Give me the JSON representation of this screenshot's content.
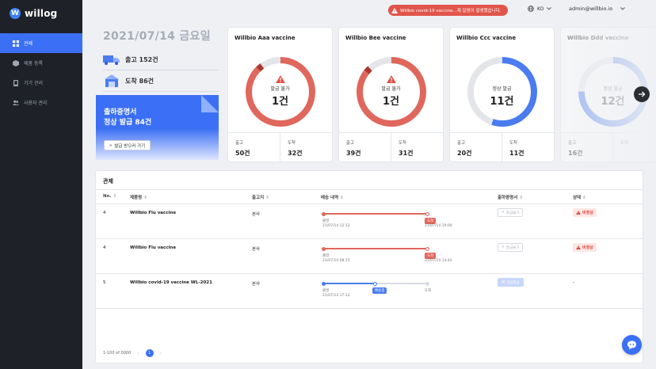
{
  "app": {
    "logo_letter": "W",
    "name": "willog"
  },
  "sidebar": {
    "items": [
      {
        "label": "관제",
        "icon": "grid-icon",
        "active": true
      },
      {
        "label": "제품 등록",
        "icon": "box-icon",
        "active": false
      },
      {
        "label": "기기 관리",
        "icon": "device-icon",
        "active": false
      },
      {
        "label": "사용자 관리",
        "icon": "users-icon",
        "active": false
      }
    ]
  },
  "topbar": {
    "alert_text": "Willbio covid-19 vaccine...제 알람이 발생했습니다.",
    "language": "KO",
    "user": "admin@willbio.io"
  },
  "summary": {
    "date": "2021/07/14 금요일",
    "outbound": "출고 152건",
    "arrival": "도착 86건"
  },
  "promo": {
    "line1": "출하증명서",
    "line2": "정상 발급 84건",
    "button": "발급 받으러 가기"
  },
  "cards": [
    {
      "title": "Willbio Aaa vaccine",
      "status_label": "발급 불가",
      "count": "1건",
      "out_label": "출고",
      "out_value": "50건",
      "arr_label": "도착",
      "arr_value": "32건",
      "fraction": 0.9,
      "color": "#e0675c"
    },
    {
      "title": "Willbio Bee vaccine",
      "status_label": "발급 불가",
      "count": "1건",
      "out_label": "출고",
      "out_value": "39건",
      "arr_label": "도착",
      "arr_value": "31건",
      "fraction": 0.88,
      "color": "#e0675c"
    },
    {
      "title": "Willbio Ccc vaccine",
      "status_label": "정상 발급",
      "count": "11건",
      "out_label": "출고",
      "out_value": "20건",
      "arr_label": "도착",
      "arr_value": "11건",
      "fraction": 0.55,
      "color": "#4a7cf0"
    },
    {
      "title": "Willbio Ddd vaccine",
      "status_label": "정상 발급",
      "count": "12건",
      "out_label": "출고",
      "out_value": "16건",
      "arr_label": "도착",
      "arr_value": "",
      "fraction": 0.75,
      "color": "#4a7cf0"
    }
  ],
  "table": {
    "title": "관제",
    "columns": [
      "No.",
      "제품명",
      "출고지",
      "배송 내역",
      "출하증명서",
      "상태"
    ],
    "rows": [
      {
        "no": "4",
        "name": "Willbio Flu vaccine",
        "origin": "본사",
        "start_label": "출발",
        "start_time": "21/07/14 12:12",
        "end_tag": "도착",
        "end_time": "21/07/14 19:00",
        "cert": "발급불가",
        "status": "비정상"
      },
      {
        "no": "4",
        "name": "Willbio Flu vaccine",
        "origin": "본사",
        "start_label": "출발",
        "start_time": "21/07/14 08:15",
        "end_tag": "도착",
        "end_time": "21/07/14 14:42",
        "cert": "발급불가",
        "status": "비정상"
      },
      {
        "no": "5",
        "name": "Willbio covid-19 vaccine WL-2021",
        "origin": "본사",
        "start_label": "출발",
        "start_time": "21/07/14 17:12",
        "mid_tag": "배송중",
        "end_label": "도착",
        "cert": "발급발급",
        "status": "-"
      }
    ],
    "pagination": {
      "range": "1-100 of 0000",
      "current": "1"
    }
  },
  "colors": {
    "accent": "#3b6ff5",
    "danger": "#e0554b",
    "sidebar": "#1e2128"
  }
}
